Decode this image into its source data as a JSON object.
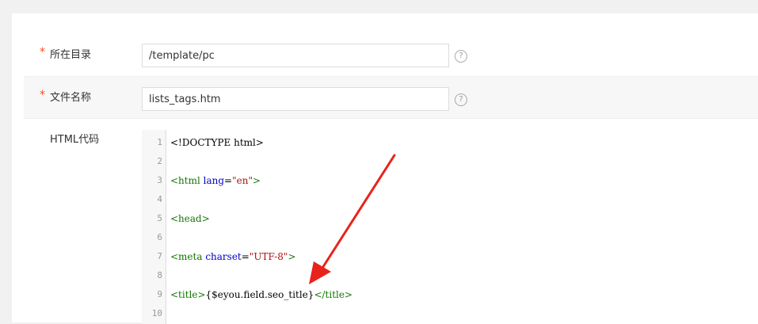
{
  "form": {
    "directory": {
      "required_mark": "*",
      "label": "所在目录",
      "value": "/template/pc",
      "help_icon": "question-circle-icon"
    },
    "filename": {
      "required_mark": "*",
      "label": "文件名称",
      "value": "lists_tags.htm",
      "help_icon": "question-circle-icon"
    },
    "html_code": {
      "label": "HTML代码"
    }
  },
  "editor": {
    "lines": [
      {
        "num": "1",
        "parts": [
          {
            "t": "<!DOCTYPE html>",
            "c": "plain"
          }
        ]
      },
      {
        "num": "2",
        "parts": []
      },
      {
        "num": "3",
        "parts": [
          {
            "t": "<html ",
            "c": "tag"
          },
          {
            "t": "lang",
            "c": "attr"
          },
          {
            "t": "=",
            "c": "plain"
          },
          {
            "t": "\"en\"",
            "c": "str"
          },
          {
            "t": ">",
            "c": "tag"
          }
        ]
      },
      {
        "num": "4",
        "parts": []
      },
      {
        "num": "5",
        "parts": [
          {
            "t": "<head>",
            "c": "tag"
          }
        ]
      },
      {
        "num": "6",
        "parts": []
      },
      {
        "num": "7",
        "parts": [
          {
            "t": "<meta ",
            "c": "tag"
          },
          {
            "t": "charset",
            "c": "attr"
          },
          {
            "t": "=",
            "c": "plain"
          },
          {
            "t": "\"UTF-8\"",
            "c": "str"
          },
          {
            "t": ">",
            "c": "tag"
          }
        ]
      },
      {
        "num": "8",
        "parts": []
      },
      {
        "num": "9",
        "parts": [
          {
            "t": "<title>",
            "c": "tag"
          },
          {
            "t": "{$eyou.field.seo_title}",
            "c": "plain"
          },
          {
            "t": "</title>",
            "c": "tag"
          }
        ]
      },
      {
        "num": "10",
        "parts": []
      }
    ]
  },
  "colors": {
    "required": "#ff4a1a",
    "arrow": "#e8231c",
    "tag": "#117700",
    "attr": "#0000cc",
    "string": "#aa1111"
  }
}
